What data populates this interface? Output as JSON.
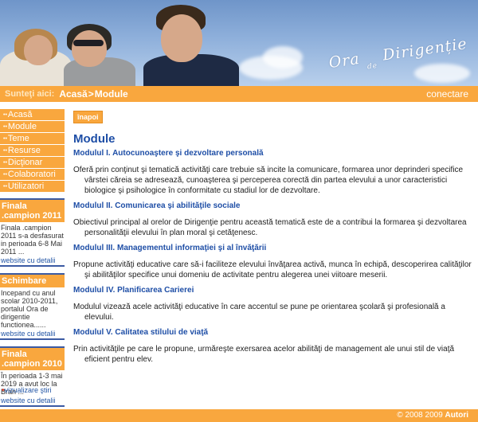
{
  "banner": {
    "logo_line1": "Ora",
    "logo_de": "de",
    "logo_line2": "Dirigenție"
  },
  "breadcrumb": {
    "label": "Sunteţi aici:",
    "items": [
      "Acasă",
      "Module"
    ],
    "separator": ">",
    "login": "conectare"
  },
  "nav": {
    "items": [
      {
        "label": "Acasă"
      },
      {
        "label": "Module"
      },
      {
        "label": "Teme"
      },
      {
        "label": "Resurse"
      },
      {
        "label": "Dicţionar"
      },
      {
        "label": "Colaboratori"
      },
      {
        "label": "Utilizatori"
      }
    ]
  },
  "news": [
    {
      "title": "Finala .campion 2011",
      "text": "Finala .campion 2011 s-a desfasurat in perioada 6-8 Mai 2011 ...",
      "link": "website cu detalii"
    },
    {
      "title": "Schimbare",
      "text": "Incepand cu anul scolar 2010-2011, portalul Ora de dirigentie functionea......",
      "link": "website cu detalii"
    },
    {
      "title": "Finala .campion 2010",
      "text": "În perioada 1-3 mai 2019 a avut loc la Bran ...",
      "link": "website cu detalii"
    }
  ],
  "news_all": "vizualizare ştiri",
  "content": {
    "back": "înapoi",
    "title": "Module",
    "modules": [
      {
        "title": "Modulul I. Autocunoaştere şi dezvoltare personală",
        "desc": "Oferă prin conţinut şi tematică activităţi care trebuie să incite la comunicare, formarea unor deprinderi specifice vârstei căreia se adresează, cunoaşterea şi perceperea corectă din partea elevului a unor caracteristici biologice şi psihologice în conformitate cu stadiul lor de dezvoltare."
      },
      {
        "title": "Modulul II. Comunicarea şi abilităţile sociale",
        "desc": "Obiectivul principal al orelor de Dirigenţie pentru această tematică este de a contribui la formarea şi dezvoltarea personalităţii elevului în plan moral şi cetăţenesc."
      },
      {
        "title": "Modulul III. Managementul informaţiei şi al învăţării",
        "desc": "Propune activităţi educative care să-i faciliteze elevului învăţarea activă, munca în echipă, descoperirea calităţilor şi abilităţilor specifice unui domeniu de activitate pentru alegerea unei viitoare meserii."
      },
      {
        "title": "Modulul IV. Planificarea Carierei",
        "desc": "Modulul vizează acele activităţi educative în care accentul se pune pe orientarea şcolară şi profesională a elevului."
      },
      {
        "title": "Modulul V. Calitatea stilului de viaţă",
        "desc": "Prin activităţile pe care le propune, urmăreşte exersarea acelor abilităţi de management ale unui stil de viaţă eficient pentru elev."
      }
    ]
  },
  "footer": {
    "copyright": "© 2008 2009",
    "authors": "Autori"
  }
}
